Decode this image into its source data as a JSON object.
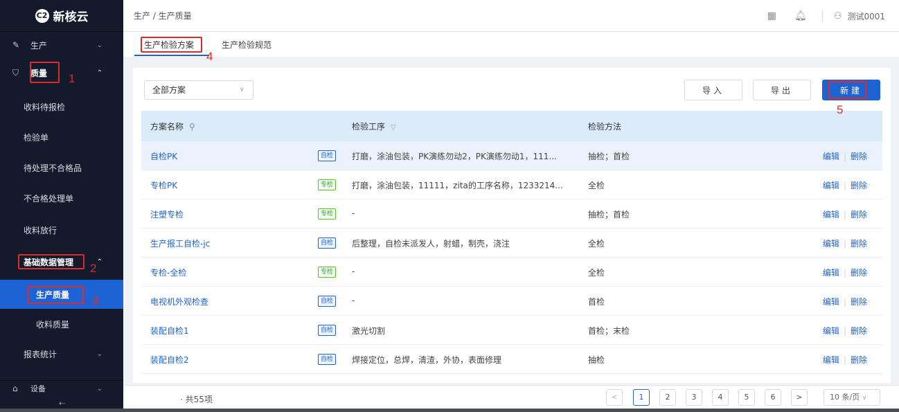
{
  "app": {
    "logo_mark": "C2",
    "name": "新核云"
  },
  "sidebar": {
    "production": "生产",
    "quality": "质量",
    "quality_items": [
      "收料待报检",
      "检验单",
      "待处理不合格品",
      "不合格处理单",
      "收料放行"
    ],
    "basic_data": "基础数据管理",
    "production_quality": "生产质量",
    "receiving_quality": "收料质量",
    "reports": "报表统计",
    "equipment": "设备",
    "collapse": "⇠"
  },
  "header": {
    "breadcrumb": "生产 / 生产质量",
    "user": "测试0001"
  },
  "tabs": [
    "生产检验方案",
    "生产检验规范"
  ],
  "toolbar": {
    "filter_value": "全部方案",
    "import_label": "导入",
    "export_label": "导出",
    "new_label": "新建"
  },
  "table": {
    "columns": [
      "方案名称",
      "检验工序",
      "检验方法"
    ],
    "rows": [
      {
        "name": "自检PK",
        "tag": "自检",
        "process": "打磨，涂油包装，PK演练勿动2，PK演练勿动1，111...",
        "method": "抽检；首检"
      },
      {
        "name": "专检PK",
        "tag": "专检",
        "process": "打磨，涂油包装，11111，zita的工序名称，1233214...",
        "method": "全检"
      },
      {
        "name": "注塑专检",
        "tag": "专检",
        "process": "-",
        "method": "抽检；首检"
      },
      {
        "name": "生产报工自检-jc",
        "tag": "自检",
        "process": "后整理，自检未派发人，射蜡，制壳，浇注",
        "method": "全检"
      },
      {
        "name": "专检-全检",
        "tag": "专检",
        "process": "-",
        "method": "全检"
      },
      {
        "name": "电视机外观检查",
        "tag": "自检",
        "process": "-",
        "method": "首检"
      },
      {
        "name": "装配自检1",
        "tag": "自检",
        "process": "激光切割",
        "method": "首检；末检"
      },
      {
        "name": "装配自检2",
        "tag": "自检",
        "process": "焊接定位，总焊，清渣，外协，表面修理",
        "method": "抽检"
      }
    ],
    "edit_label": "编辑",
    "delete_label": "删除"
  },
  "pagination": {
    "total": "· 共55项",
    "pages": [
      "1",
      "2",
      "3",
      "4",
      "5",
      "6"
    ],
    "prev": "<",
    "next": ">",
    "page_size": "10 条/页"
  },
  "annotations": [
    "1",
    "2",
    "3",
    "4",
    "5"
  ]
}
